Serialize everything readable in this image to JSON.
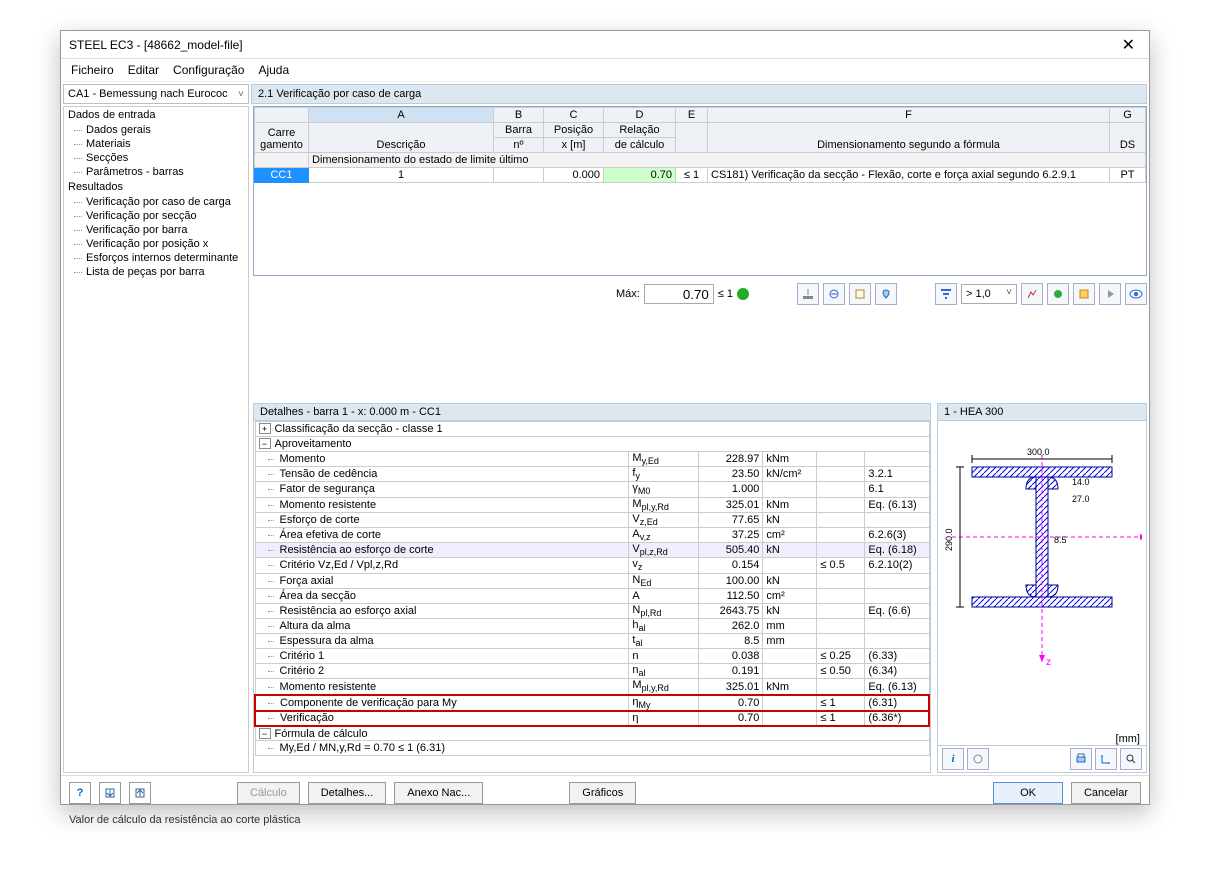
{
  "window": {
    "title": "STEEL EC3 - [48662_model-file]"
  },
  "menu": {
    "file": "Ficheiro",
    "edit": "Editar",
    "config": "Configuração",
    "help": "Ajuda"
  },
  "loadcase_combo": "CA1 - Bemessung nach Eurococ",
  "section_header": "2.1 Verificação por caso de carga",
  "tree": {
    "root1": "Dados de entrada",
    "t1": "Dados gerais",
    "t2": "Materiais",
    "t3": "Secções",
    "t4": "Parâmetros - barras",
    "root2": "Resultados",
    "r1": "Verificação por caso de carga",
    "r2": "Verificação por secção",
    "r3": "Verificação por barra",
    "r4": "Verificação por posição x",
    "r5": "Esforços internos determinante",
    "r6": "Lista de peças por barra"
  },
  "grid": {
    "cols": {
      "A": "A",
      "B": "B",
      "C": "C",
      "D": "D",
      "E": "E",
      "F": "F",
      "G": "G"
    },
    "head1": {
      "carre": "Carre",
      "gamento": "gamento",
      "descricao": "Descrição",
      "barra": "Barra",
      "no": "nº",
      "posicao": "Posição",
      "xm": "x [m]",
      "relacao": "Relação",
      "calc": "de cálculo",
      "formula": "Dimensionamento segundo a fórmula",
      "ds": "DS"
    },
    "subheader": "Dimensionamento do estado de limite último",
    "row": {
      "cc1": "CC1",
      "barra": "1",
      "pos": "0.000",
      "ratio": "0.70",
      "limit": "≤ 1",
      "formula": "CS181) Verificação da secção - Flexão, corte e força axial segundo 6.2.9.1",
      "ds": "PT"
    }
  },
  "toolbar": {
    "max_label": "Máx:",
    "max_val": "0.70",
    "max_lim": "≤ 1",
    "combo_val": "> 1,0"
  },
  "details": {
    "title": "Detalhes - barra 1 - x: 0.000 m - CC1",
    "rows": [
      {
        "exp": "+",
        "label": "Classificação da secção - classe 1"
      },
      {
        "exp": "-",
        "label": "Aproveitamento"
      },
      {
        "label": "Momento",
        "sym": "My,Ed",
        "val": "228.97",
        "unit": "kNm",
        "lim": "",
        "ref": ""
      },
      {
        "label": "Tensão de cedência",
        "sym": "fy",
        "val": "23.50",
        "unit": "kN/cm²",
        "lim": "",
        "ref": "3.2.1"
      },
      {
        "label": "Fator de segurança",
        "sym": "γM0",
        "val": "1.000",
        "unit": "",
        "lim": "",
        "ref": "6.1"
      },
      {
        "label": "Momento resistente",
        "sym": "Mpl,y,Rd",
        "val": "325.01",
        "unit": "kNm",
        "lim": "",
        "ref": "Eq. (6.13)"
      },
      {
        "label": "Esforço de corte",
        "sym": "Vz,Ed",
        "val": "77.65",
        "unit": "kN",
        "lim": "",
        "ref": ""
      },
      {
        "label": "Área efetiva de corte",
        "sym": "Av,z",
        "val": "37.25",
        "unit": "cm²",
        "lim": "",
        "ref": "6.2.6(3)"
      },
      {
        "label": "Resistência ao esforço de corte",
        "sym": "Vpl,z,Rd",
        "val": "505.40",
        "unit": "kN",
        "lim": "",
        "ref": "Eq. (6.18)",
        "shade": true
      },
      {
        "label": "Critério Vz,Ed / Vpl,z,Rd",
        "sym": "vz",
        "val": "0.154",
        "unit": "",
        "lim": "≤ 0.5",
        "ref": "6.2.10(2)"
      },
      {
        "label": "Força axial",
        "sym": "NEd",
        "val": "100.00",
        "unit": "kN",
        "lim": "",
        "ref": ""
      },
      {
        "label": "Área da secção",
        "sym": "A",
        "val": "112.50",
        "unit": "cm²",
        "lim": "",
        "ref": ""
      },
      {
        "label": "Resistência ao esforço axial",
        "sym": "Npl,Rd",
        "val": "2643.75",
        "unit": "kN",
        "lim": "",
        "ref": "Eq. (6.6)"
      },
      {
        "label": "Altura da alma",
        "sym": "hal",
        "val": "262.0",
        "unit": "mm",
        "lim": "",
        "ref": ""
      },
      {
        "label": "Espessura da alma",
        "sym": "tal",
        "val": "8.5",
        "unit": "mm",
        "lim": "",
        "ref": ""
      },
      {
        "label": "Critério 1",
        "sym": "n",
        "val": "0.038",
        "unit": "",
        "lim": "≤ 0.25",
        "ref": "(6.33)"
      },
      {
        "label": "Critério 2",
        "sym": "nal",
        "val": "0.191",
        "unit": "",
        "lim": "≤ 0.50",
        "ref": "(6.34)"
      },
      {
        "label": "Momento resistente",
        "sym": "Mpl,y,Rd",
        "val": "325.01",
        "unit": "kNm",
        "lim": "",
        "ref": "Eq. (6.13)"
      },
      {
        "label": "Componente de verificação para My",
        "sym": "ηMy",
        "val": "0.70",
        "unit": "",
        "lim": "≤ 1",
        "ref": "(6.31)",
        "hl": true
      },
      {
        "label": "Verificação",
        "sym": "η",
        "val": "0.70",
        "unit": "",
        "lim": "≤ 1",
        "ref": "(6.36*)",
        "hl": true
      },
      {
        "exp": "-",
        "label": "Fórmula de cálculo"
      },
      {
        "label": "My,Ed / MN,y,Rd = 0.70 ≤ 1   (6.31)",
        "full": true
      }
    ]
  },
  "section_view": {
    "title": "1 - HEA 300",
    "unit": "[mm]",
    "dims": {
      "width": "300.0",
      "height": "290.0",
      "tf": "14.0",
      "tw": "8.5",
      "r": "27.0"
    }
  },
  "buttons": {
    "calc": "Cálculo",
    "details": "Detalhes...",
    "anexo": "Anexo Nac...",
    "graficos": "Gráficos",
    "ok": "OK",
    "cancel": "Cancelar"
  },
  "status": "Valor de cálculo da resistência ao corte plástica"
}
